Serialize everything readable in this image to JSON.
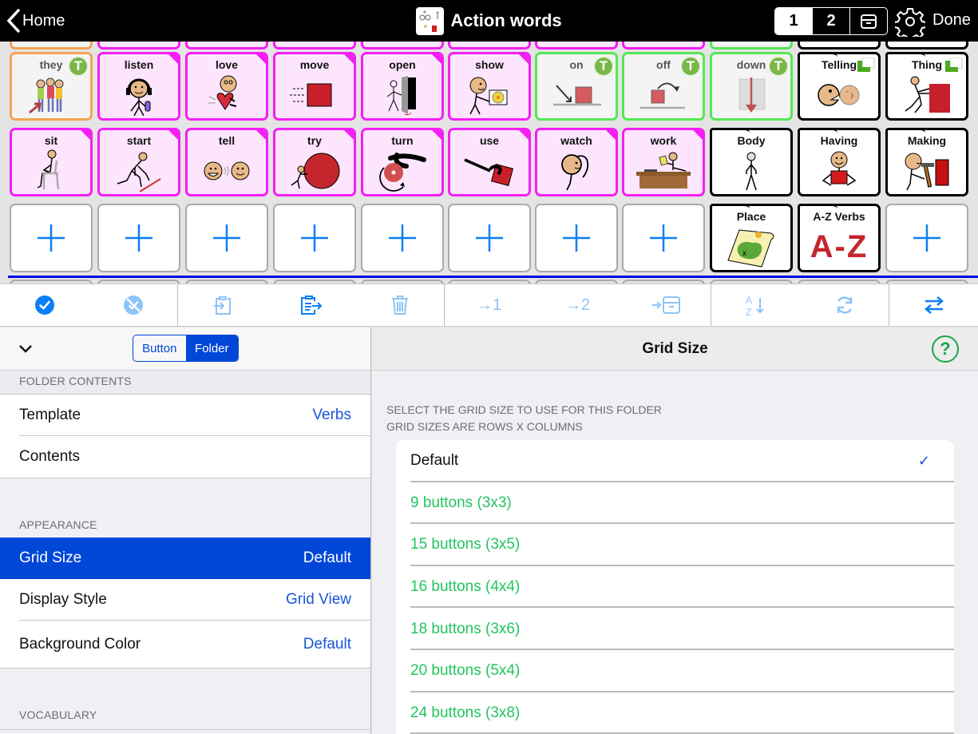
{
  "topbar": {
    "home_label": "Home",
    "title": "Action words",
    "pages": [
      "1",
      "2"
    ],
    "active_page": "1",
    "done_label": "Done"
  },
  "grid": {
    "top_partial_row": [
      {
        "style": "orange"
      },
      {
        "style": "pink"
      },
      {
        "style": "pink"
      },
      {
        "style": "pink"
      },
      {
        "style": "pink"
      },
      {
        "style": "pink"
      },
      {
        "style": "pink"
      },
      {
        "style": "pink"
      },
      {
        "style": "green"
      },
      {
        "style": "folder"
      },
      {
        "style": "folder"
      }
    ],
    "row1": [
      {
        "label": "they",
        "style": "orange",
        "badge": "T",
        "icon": "group-people-icon"
      },
      {
        "label": "listen",
        "style": "pink",
        "icon": "headphones-person-icon"
      },
      {
        "label": "love",
        "style": "pink",
        "icon": "heart-hug-icon"
      },
      {
        "label": "move",
        "style": "pink",
        "icon": "moving-box-icon"
      },
      {
        "label": "open",
        "style": "pink",
        "icon": "open-door-icon"
      },
      {
        "label": "show",
        "style": "pink",
        "icon": "show-picture-icon"
      },
      {
        "label": "on",
        "style": "green",
        "badge": "T",
        "icon": "on-arrow-icon"
      },
      {
        "label": "off",
        "style": "green",
        "badge": "T",
        "icon": "off-arrow-icon"
      },
      {
        "label": "down",
        "style": "green",
        "badge": "T",
        "icon": "down-arrow-icon"
      },
      {
        "label": "Telling",
        "style": "folder",
        "badge": "square",
        "icon": "talking-faces-icon"
      },
      {
        "label": "Thing",
        "style": "folder",
        "badge": "square",
        "icon": "pushing-box-icon"
      }
    ],
    "row2": [
      {
        "label": "sit",
        "style": "pink",
        "icon": "sitting-chair-icon"
      },
      {
        "label": "start",
        "style": "pink",
        "icon": "starting-line-icon"
      },
      {
        "label": "tell",
        "style": "pink",
        "icon": "tell-faces-icon"
      },
      {
        "label": "try",
        "style": "pink",
        "icon": "pushing-ball-icon"
      },
      {
        "label": "turn",
        "style": "pink",
        "icon": "turn-knob-icon"
      },
      {
        "label": "use",
        "style": "pink",
        "icon": "use-tool-icon"
      },
      {
        "label": "watch",
        "style": "pink",
        "icon": "watching-person-icon"
      },
      {
        "label": "work",
        "style": "pink",
        "icon": "desk-work-icon"
      },
      {
        "label": "Body",
        "style": "folder",
        "icon": "body-figure-icon"
      },
      {
        "label": "Having",
        "style": "folder",
        "icon": "holding-box-icon"
      },
      {
        "label": "Making",
        "style": "folder",
        "icon": "hammer-icon"
      }
    ],
    "row3": [
      {
        "style": "empty"
      },
      {
        "style": "empty"
      },
      {
        "style": "empty"
      },
      {
        "style": "empty"
      },
      {
        "style": "empty"
      },
      {
        "style": "empty"
      },
      {
        "style": "empty"
      },
      {
        "style": "empty"
      },
      {
        "label": "Place",
        "style": "folder",
        "icon": "treasure-map-icon"
      },
      {
        "label": "A-Z Verbs",
        "style": "folder",
        "icon": "a-z-icon",
        "icon_text": "A-Z"
      },
      {
        "style": "empty"
      }
    ]
  },
  "toolbar": {
    "groups": [
      [
        {
          "icon": "check-circle-icon",
          "active": true
        },
        {
          "icon": "uncheck-circle-icon",
          "active": false
        }
      ],
      [
        {
          "icon": "paste-in-icon",
          "active": false
        },
        {
          "icon": "copy-out-icon",
          "active": true
        },
        {
          "icon": "trash-icon",
          "active": false
        }
      ],
      [
        {
          "icon": "move-to-page-1-icon",
          "text": "→1",
          "active": false
        },
        {
          "icon": "move-to-page-2-icon",
          "text": "→2",
          "active": false
        },
        {
          "icon": "move-to-archive-icon",
          "active": false
        }
      ],
      [
        {
          "icon": "sort-az-icon",
          "active": false
        },
        {
          "icon": "refresh-icon",
          "active": false
        }
      ],
      [
        {
          "icon": "swap-icon",
          "active": true
        }
      ]
    ]
  },
  "left_panel": {
    "segment": {
      "options": [
        "Button",
        "Folder"
      ],
      "selected": "Folder"
    },
    "sections": [
      {
        "header": "FOLDER CONTENTS",
        "rows": [
          {
            "label": "Template",
            "value": "Verbs"
          },
          {
            "label": "Contents",
            "value": ""
          }
        ]
      },
      {
        "header": "APPEARANCE",
        "rows": [
          {
            "label": "Grid Size",
            "value": "Default",
            "selected": true
          },
          {
            "label": "Display Style",
            "value": "Grid View"
          },
          {
            "label": "Background Color",
            "value": "Default"
          }
        ]
      },
      {
        "header": "VOCABULARY",
        "rows": []
      }
    ]
  },
  "right_panel": {
    "title": "Grid Size",
    "help_label": "?",
    "description_line1": "SELECT THE GRID SIZE TO USE FOR THIS FOLDER",
    "description_line2": "GRID SIZES ARE ROWS X COLUMNS",
    "options": [
      {
        "label": "Default",
        "checked": true
      },
      {
        "label": "9 buttons (3x3)"
      },
      {
        "label": "15 buttons (3x5)"
      },
      {
        "label": "16 buttons (4x4)"
      },
      {
        "label": "18 buttons (3x6)"
      },
      {
        "label": "20 buttons (5x4)"
      },
      {
        "label": "24 buttons (3x8)"
      }
    ],
    "check_mark": "✓"
  },
  "colors": {
    "pink_border": "#f41ef4",
    "pink_fill": "#fde6fd",
    "green_border": "#55e855",
    "orange_border": "#f5a454",
    "selection_blue": "#0047d8",
    "toolbar_blue": "#0a7ff5",
    "grid_option_green": "#22c55e",
    "insert_line": "#0000ee"
  }
}
